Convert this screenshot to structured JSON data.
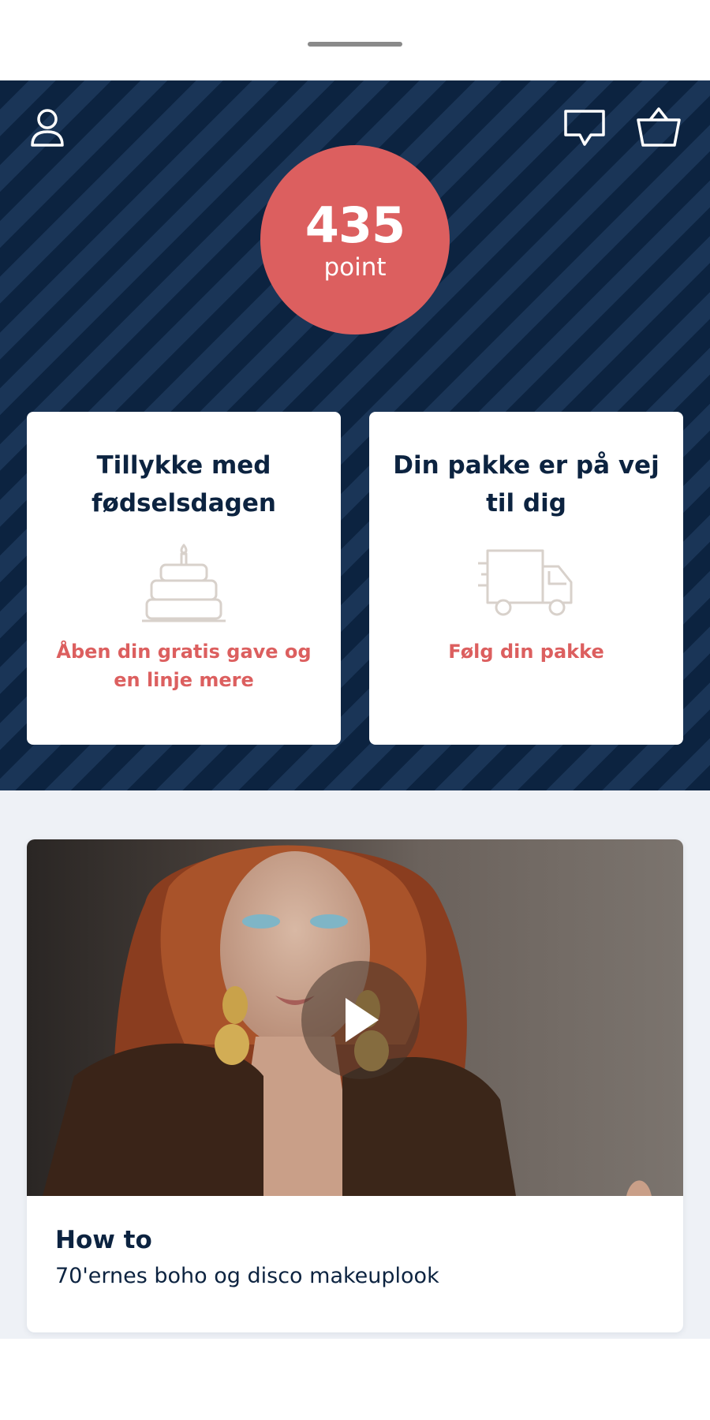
{
  "header": {
    "icons": {
      "profile": "user-icon",
      "messages": "chat-bubble-icon",
      "basket": "shopping-basket-icon"
    }
  },
  "points": {
    "value": "435",
    "label": "point"
  },
  "cards": [
    {
      "title": "Tillykke med fødselsdagen",
      "icon": "birthday-cake-icon",
      "link": "Åben din gratis gave og en linje mere"
    },
    {
      "title": "Din pakke er på vej til dig",
      "icon": "delivery-truck-icon",
      "link": "Følg din pakke"
    }
  ],
  "video": {
    "kicker": "How to",
    "title": "70'ernes boho og disco makeuplook",
    "icon": "play-icon"
  },
  "colors": {
    "navy": "#0c2340",
    "stripe": "#1a3557",
    "accent": "#dc5f5f",
    "illustration": "#d8d1cb",
    "background": "#eef1f6"
  }
}
